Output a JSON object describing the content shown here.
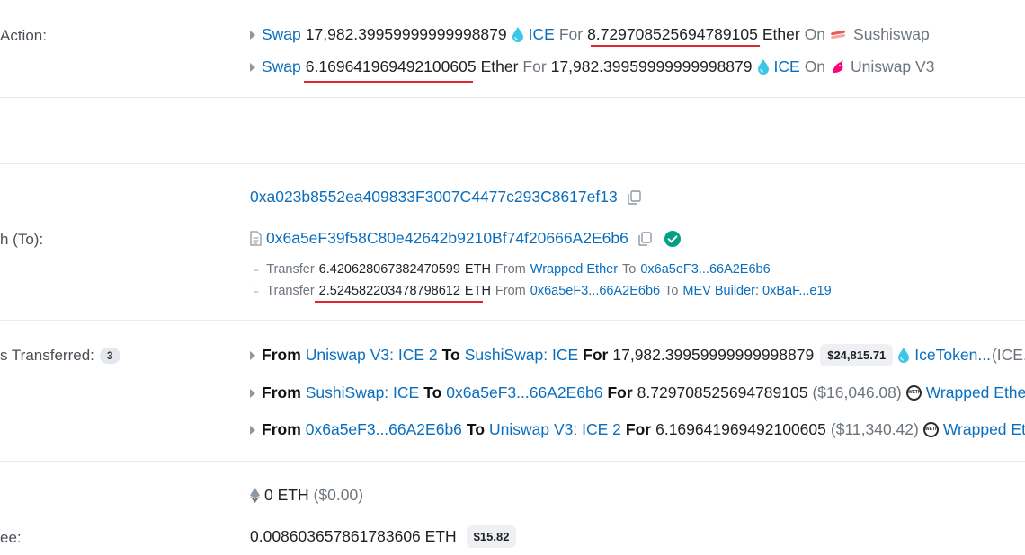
{
  "labels": {
    "action": "Action:",
    "to": "h (To):",
    "transferred": "s Transferred:",
    "transferred_count": "3",
    "fee": "ee:"
  },
  "actions": [
    {
      "verb": "Swap",
      "amount": "17,982.39959999999998879",
      "token": "ICE",
      "for_word": "For",
      "amount2": "8.729708525694789105",
      "unit2": "Ether",
      "on_word": "On",
      "dex": "Sushiswap"
    },
    {
      "verb": "Swap",
      "amount": "6.169641969492100605",
      "unit": "Ether",
      "for_word": "For",
      "amount2": "17,982.39959999999998879",
      "token2": "ICE",
      "on_word": "On",
      "dex": "Uniswap V3"
    }
  ],
  "from_address": "0xa023b8552ea409833F3007C4477c293C8617ef13",
  "to_address": "0x6a5eF39f58C80e42642b9210Bf74f20666A2E6b6",
  "internal_transfers": [
    {
      "word": "Transfer",
      "amount": "6.420628067382470599",
      "unit": "ETH",
      "from_word": "From",
      "from": "Wrapped Ether",
      "to_word": "To",
      "to": "0x6a5eF3...66A2E6b6"
    },
    {
      "word": "Transfer",
      "amount": "2.524582203478798612",
      "unit": "ETH",
      "from_word": "From",
      "from": "0x6a5eF3...66A2E6b6",
      "to_word": "To",
      "to": "MEV Builder: 0xBaF...e19"
    }
  ],
  "token_transfers": [
    {
      "from_word": "From",
      "from": "Uniswap V3: ICE 2",
      "to_word": "To",
      "to": "SushiSwap: ICE",
      "for_word": "For",
      "amount": "17,982.39959999999998879",
      "value_pill": "$24,815.71",
      "value_text": "",
      "token": "IceToken...",
      "token_suffix": "(ICE..."
    },
    {
      "from_word": "From",
      "from": "SushiSwap: ICE",
      "to_word": "To",
      "to": "0x6a5eF3...66A2E6b6",
      "for_word": "For",
      "amount": "8.729708525694789105",
      "value_pill": "",
      "value_text": "($16,046.08)",
      "token": "Wrapped Ethe...",
      "token_suffix": ""
    },
    {
      "from_word": "From",
      "from": "0x6a5eF3...66A2E6b6",
      "to_word": "To",
      "to": "Uniswap V3: ICE 2",
      "for_word": "For",
      "amount": "6.169641969492100605",
      "value_pill": "",
      "value_text": "($11,340.42)",
      "token": "Wrapped Eth",
      "token_suffix": ""
    }
  ],
  "value": {
    "amount": "0 ETH",
    "usd": "($0.00)"
  },
  "fee": {
    "amount": "0.008603657861783606 ETH",
    "usd": "$15.82"
  },
  "weth_icon_text": "WETH",
  "colors": {
    "link": "#0a6ebd",
    "underline": "#e0242b",
    "success": "#00a186"
  }
}
